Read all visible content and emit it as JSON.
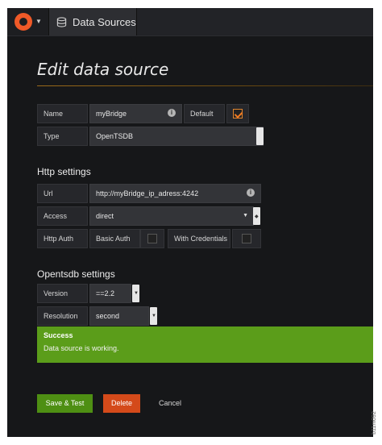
{
  "topbar": {
    "tab_label": "Data Sources"
  },
  "page": {
    "title": "Edit data source"
  },
  "basic": {
    "name_label": "Name",
    "name_value": "myBridge",
    "default_label": "Default",
    "default_checked": true,
    "type_label": "Type",
    "type_value": "OpenTSDB"
  },
  "http": {
    "heading": "Http settings",
    "url_label": "Url",
    "url_value": "http://myBridge_ip_adress:4242",
    "access_label": "Access",
    "access_value": "direct",
    "auth_label": "Http Auth",
    "basic_auth_label": "Basic Auth",
    "with_credentials_label": "With Credentials"
  },
  "opentsdb": {
    "heading": "Opentsdb settings",
    "version_label": "Version",
    "version_value": "==2.2",
    "resolution_label": "Resolution",
    "resolution_value": "second"
  },
  "alert": {
    "title": "Success",
    "message": "Data source is working."
  },
  "actions": {
    "save_label": "Save & Test",
    "delete_label": "Delete",
    "cancel_label": "Cancel"
  },
  "watermark": {
    "text": "b11m092"
  },
  "colors": {
    "background": "#161719",
    "accent": "#f05a28",
    "success": "#5b9d1a",
    "save_button": "#4e8f13",
    "delete_button": "#d44a1a"
  }
}
